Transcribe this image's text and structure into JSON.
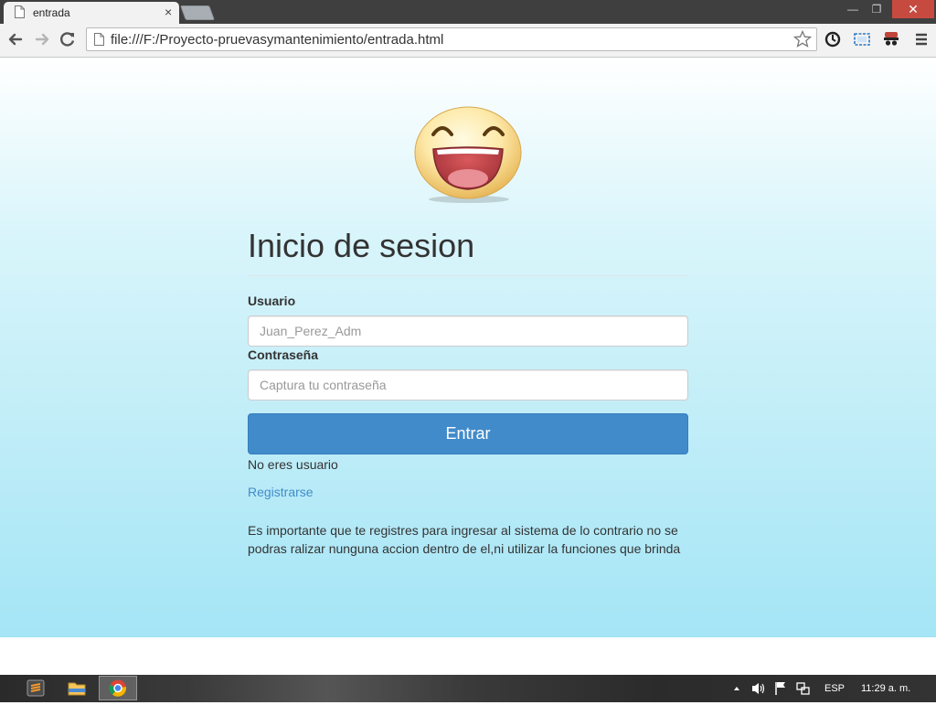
{
  "browser": {
    "tab_title": "entrada",
    "tab_close": "×",
    "url": "file:///F:/Proyecto-pruevasymantenimiento/entrada.html",
    "window": {
      "minimize": "—",
      "maximize": "❐",
      "close": "✕"
    }
  },
  "login": {
    "heading": "Inicio de sesion",
    "user_label": "Usuario",
    "user_placeholder": "Juan_Perez_Adm",
    "password_label": "Contraseña",
    "password_placeholder": "Captura tu contraseña",
    "submit_label": "Entrar",
    "no_user_text": "No eres usuario",
    "register_link": "Registrarse",
    "note": "Es importante que te registres para ingresar al sistema de lo contrario no se podras ralizar nunguna accion dentro de el,ni utilizar la funciones que brinda"
  },
  "taskbar": {
    "language": "ESP",
    "clock": "11:29 a. m."
  },
  "colors": {
    "primary_button": "#428bca",
    "link": "#428bca",
    "page_gradient_bottom": "#a4e5f6",
    "close_button": "#c74a41"
  },
  "icons": [
    "page-icon",
    "back-arrow-icon",
    "forward-arrow-icon",
    "reload-icon",
    "star-icon",
    "smiley-icon",
    "hamburger-menu-icon"
  ]
}
